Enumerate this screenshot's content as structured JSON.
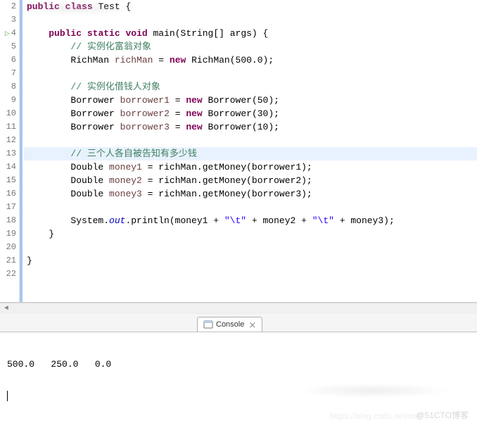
{
  "lines": [
    {
      "n": 2,
      "run": false
    },
    {
      "n": 3,
      "run": false
    },
    {
      "n": 4,
      "run": true
    },
    {
      "n": 5,
      "run": false
    },
    {
      "n": 6,
      "run": false
    },
    {
      "n": 7,
      "run": false
    },
    {
      "n": 8,
      "run": false
    },
    {
      "n": 9,
      "run": false
    },
    {
      "n": 10,
      "run": false
    },
    {
      "n": 11,
      "run": false
    },
    {
      "n": 12,
      "run": false
    },
    {
      "n": 13,
      "run": false,
      "hl": true
    },
    {
      "n": 14,
      "run": false
    },
    {
      "n": 15,
      "run": false
    },
    {
      "n": 16,
      "run": false
    },
    {
      "n": 17,
      "run": false
    },
    {
      "n": 18,
      "run": false
    },
    {
      "n": 19,
      "run": false
    },
    {
      "n": 20,
      "run": false
    },
    {
      "n": 21,
      "run": false
    },
    {
      "n": 22,
      "run": false
    }
  ],
  "code": {
    "l2": {
      "kw1": "public",
      "kw2": "class",
      "cls": "Test",
      "brace": "{"
    },
    "l4": {
      "kw1": "public",
      "kw2": "static",
      "kw3": "void",
      "name": "main",
      "sig": "(String[] args) {"
    },
    "l5": {
      "c": "// 实例化富翁对象"
    },
    "l6": {
      "t": "RichMan",
      "v": "richMan",
      "eq": "=",
      "kw": "new",
      "ctor": "RichMan(500.0);"
    },
    "l8": {
      "c": "// 实例化借钱人对象"
    },
    "l9": {
      "t": "Borrower",
      "v": "borrower1",
      "eq": "=",
      "kw": "new",
      "ctor": "Borrower(50);"
    },
    "l10": {
      "t": "Borrower",
      "v": "borrower2",
      "eq": "=",
      "kw": "new",
      "ctor": "Borrower(30);"
    },
    "l11": {
      "t": "Borrower",
      "v": "borrower3",
      "eq": "=",
      "kw": "new",
      "ctor": "Borrower(10);"
    },
    "l13": {
      "c": "// 三个人各自被告知有多少钱"
    },
    "l14": {
      "t": "Double",
      "v": "money1",
      "eq": "=",
      "rhs": "richMan.getMoney(borrower1);"
    },
    "l15": {
      "t": "Double",
      "v": "money2",
      "eq": "=",
      "rhs": "richMan.getMoney(borrower2);"
    },
    "l16": {
      "t": "Double",
      "v": "money3",
      "eq": "=",
      "rhs": "richMan.getMoney(borrower3);"
    },
    "l18": {
      "sys": "System.",
      "out": "out",
      "rest": ".println(money1 + ",
      "s1": "\"\\t\"",
      "mid": " + money2 + ",
      "s2": "\"\\t\"",
      "end": " + money3);"
    },
    "l19": {
      "brace": "}"
    },
    "l21": {
      "brace": "}"
    }
  },
  "console": {
    "tab_label": "Console",
    "output": "500.0   250.0   0.0"
  },
  "watermark": "@51CTO博客",
  "watermark2": "https://blog.csdn.net/wei"
}
